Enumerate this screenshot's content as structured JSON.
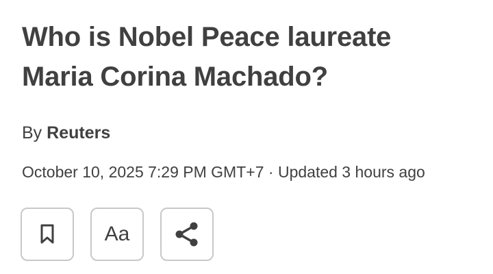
{
  "article": {
    "headline_line1": "Who is Nobel Peace laureate",
    "headline_line2": "Maria Corina Machado?",
    "byline_prefix": "By",
    "author": "Reuters",
    "date": "October 10, 2025 7:29 PM GMT+7",
    "separator": "·",
    "updated": "Updated 3 hours ago"
  },
  "toolbar": {
    "bookmark_icon": "bookmark-icon",
    "text_size_label": "Aa",
    "share_icon": "share-icon"
  },
  "colors": {
    "text": "#404040",
    "button_border": "#c8c8c8",
    "background": "#ffffff"
  }
}
